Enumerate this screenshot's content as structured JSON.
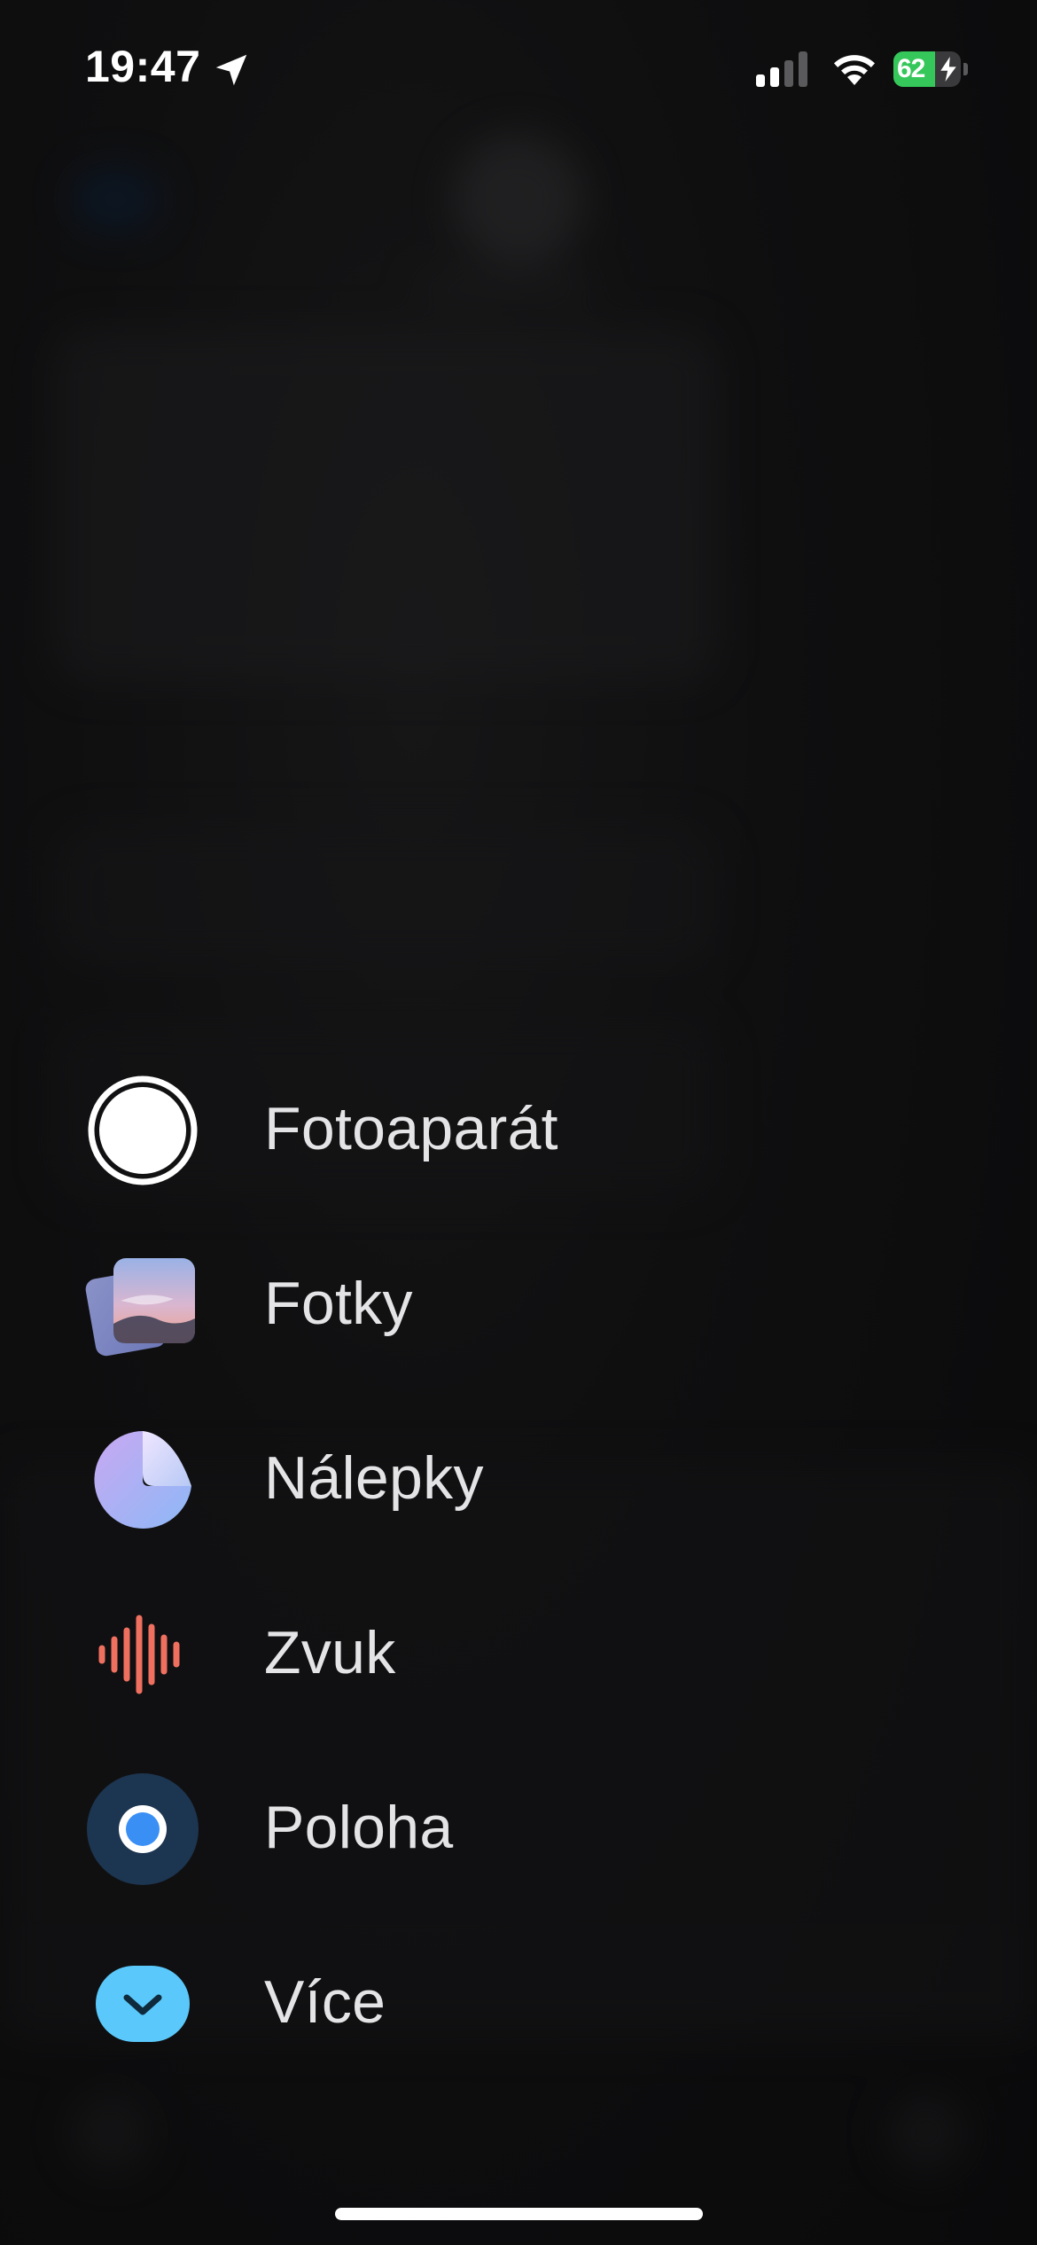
{
  "status_bar": {
    "time": "19:47",
    "battery_percent": "62",
    "battery_level": 0.62,
    "icons": [
      "location-arrow-icon",
      "cellular-signal-icon",
      "wifi-icon",
      "battery-charging-icon"
    ]
  },
  "colors": {
    "battery_green": "#35c759",
    "audio_red": "#f07060",
    "location_blue": "#3a8ff5",
    "more_blue": "#5ac8fa",
    "sticker_purple": "#b9a6f5"
  },
  "menu": {
    "items": [
      {
        "label": "Fotoaparát",
        "icon": "camera-shutter-icon"
      },
      {
        "label": "Fotky",
        "icon": "photos-icon"
      },
      {
        "label": "Nálepky",
        "icon": "stickers-icon"
      },
      {
        "label": "Zvuk",
        "icon": "audio-waveform-icon"
      },
      {
        "label": "Poloha",
        "icon": "location-icon"
      },
      {
        "label": "Více",
        "icon": "more-chevron-icon"
      }
    ]
  }
}
